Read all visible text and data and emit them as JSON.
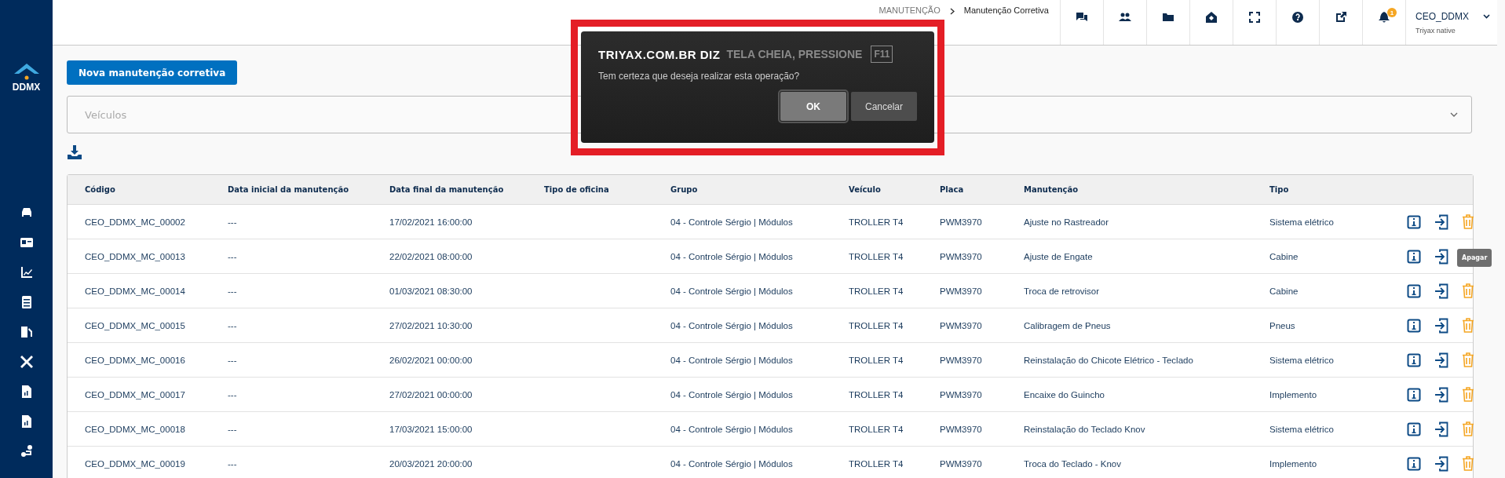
{
  "sidebar": {
    "logo": "DDMX"
  },
  "breadcrumb": [
    "MANUTENÇÃO",
    "Manutenção Corretiva"
  ],
  "notification_badge": "1",
  "user": {
    "name": "CEO_DDMX",
    "subtitle": "Triyax native"
  },
  "new_button": "Nova manutenção corretiva",
  "vehicle_select": {
    "placeholder": "Veículos"
  },
  "table": {
    "columns": [
      "Código",
      "Data inicial da manutenção",
      "Data final da manutenção",
      "Tipo de oficina",
      "Grupo",
      "Veículo",
      "Placa",
      "Manutenção",
      "Tipo"
    ],
    "rows": [
      [
        "CEO_DDMX_MC_00002",
        "---",
        "17/02/2021 16:00:00",
        "",
        "04 - Controle Sérgio | Módulos",
        "TROLLER T4",
        "PWM3970",
        "Ajuste no Rastreador",
        "Sistema elétrico"
      ],
      [
        "CEO_DDMX_MC_00013",
        "---",
        "22/02/2021 08:00:00",
        "",
        "04 - Controle Sérgio | Módulos",
        "TROLLER T4",
        "PWM3970",
        "Ajuste de Engate",
        "Cabine"
      ],
      [
        "CEO_DDMX_MC_00014",
        "---",
        "01/03/2021 08:30:00",
        "",
        "04 - Controle Sérgio | Módulos",
        "TROLLER T4",
        "PWM3970",
        "Troca de retrovisor",
        "Cabine"
      ],
      [
        "CEO_DDMX_MC_00015",
        "---",
        "27/02/2021 10:30:00",
        "",
        "04 - Controle Sérgio | Módulos",
        "TROLLER T4",
        "PWM3970",
        "Calibragem de Pneus",
        "Pneus"
      ],
      [
        "CEO_DDMX_MC_00016",
        "---",
        "26/02/2021 00:00:00",
        "",
        "04 - Controle Sérgio | Módulos",
        "TROLLER T4",
        "PWM3970",
        "Reinstalação do Chicote Elétrico - Teclado",
        "Sistema elétrico"
      ],
      [
        "CEO_DDMX_MC_00017",
        "---",
        "27/02/2021 00:00:00",
        "",
        "04 - Controle Sérgio | Módulos",
        "TROLLER T4",
        "PWM3970",
        "Encaixe do Guincho",
        "Implemento"
      ],
      [
        "CEO_DDMX_MC_00018",
        "---",
        "17/03/2021 15:00:00",
        "",
        "04 - Controle Sérgio | Módulos",
        "TROLLER T4",
        "PWM3970",
        "Reinstalação do Teclado Knov",
        "Sistema elétrico"
      ],
      [
        "CEO_DDMX_MC_00019",
        "---",
        "20/03/2021 20:00:00",
        "",
        "04 - Controle Sérgio | Módulos",
        "TROLLER T4",
        "PWM3970",
        "Troca do Teclado - Knov",
        "Implemento"
      ]
    ]
  },
  "tooltip": {
    "text": "Apagar"
  },
  "fullscreen_notice": {
    "text": "TELA CHEIA, PRESSIONE",
    "key": "F11"
  },
  "dialog": {
    "title": "TRIYAX.COM.BR DIZ",
    "message": "Tem certeza que deseja realizar esta operação?",
    "buttons": [
      {
        "label": "OK",
        "selected": true
      },
      {
        "label": "Cancelar",
        "selected": false
      }
    ]
  }
}
